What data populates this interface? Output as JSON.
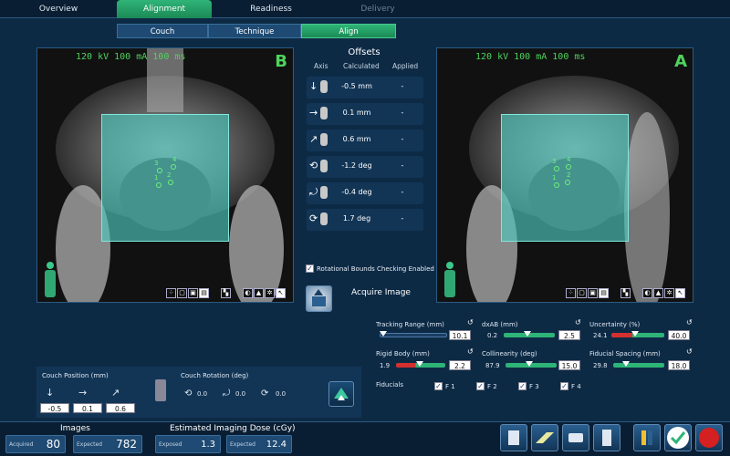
{
  "tabs": [
    {
      "label": "Overview"
    },
    {
      "label": "Alignment"
    },
    {
      "label": "Readiness"
    },
    {
      "label": "Delivery"
    }
  ],
  "steps": [
    {
      "label": "Couch"
    },
    {
      "label": "Technique"
    },
    {
      "label": "Align"
    }
  ],
  "imageB": {
    "kv": "120 kV 100 mA 100 ms",
    "letter": "B",
    "fiducials": [
      "3",
      "4",
      "1",
      "2"
    ]
  },
  "imageA": {
    "kv": "120 kV 100 mA 100 ms",
    "letter": "A",
    "fiducials": [
      "3",
      "4",
      "1",
      "2"
    ]
  },
  "offsets": {
    "title": "Offsets",
    "head_axis": "Axis",
    "head_calc": "Calculated",
    "head_app": "Applied",
    "rows": [
      {
        "icon": "arrow-down-icon",
        "calc": "-0.5 mm",
        "applied": "-"
      },
      {
        "icon": "arrow-right-icon",
        "calc": "0.1 mm",
        "applied": "-"
      },
      {
        "icon": "arrow-diagonal-icon",
        "calc": "0.6 mm",
        "applied": "-"
      },
      {
        "icon": "rotate-roll-icon",
        "calc": "-1.2 deg",
        "applied": "-"
      },
      {
        "icon": "rotate-pitch-icon",
        "calc": "-0.4 deg",
        "applied": "-"
      },
      {
        "icon": "rotate-yaw-icon",
        "calc": "1.7 deg",
        "applied": "-"
      }
    ]
  },
  "rot_check": {
    "label": "Rotational Bounds Checking Enabled",
    "checked": true
  },
  "acquire": {
    "label": "Acquire Image"
  },
  "couch_position": {
    "label": "Couch Position (mm)",
    "values": [
      "-0.5",
      "0.1",
      "0.6"
    ]
  },
  "couch_rotation": {
    "label": "Couch Rotation (deg)",
    "values": [
      "0.0",
      "0.0",
      "0.0"
    ]
  },
  "tolerances": {
    "tracking_range": {
      "label": "Tracking Range (mm)",
      "value": "10.1"
    },
    "dxab": {
      "label": "dxAB (mm)",
      "left": "0.2",
      "value": "2.5"
    },
    "uncertainty": {
      "label": "Uncertainty (%)",
      "left": "24.1",
      "value": "40.0"
    },
    "rigid_body": {
      "label": "Rigid Body (mm)",
      "left": "1.9",
      "value": "2.2"
    },
    "collinearity": {
      "label": "Collinearity (deg)",
      "left": "87.9",
      "value": "15.0"
    },
    "fiducial_spacing": {
      "label": "Fiducial Spacing (mm)",
      "left": "29.8",
      "value": "18.0"
    }
  },
  "fiducials": {
    "label": "Fiducials",
    "items": [
      "F 1",
      "F 2",
      "F 3",
      "F 4"
    ]
  },
  "footer": {
    "images_title": "Images",
    "acquired_label": "Acquired",
    "acquired": "80",
    "expected_label": "Expected",
    "expected": "782",
    "dose_title": "Estimated Imaging Dose (cGy)",
    "exposed_label": "Exposed",
    "exposed": "1.3",
    "dose_expected_label": "Expected",
    "dose_expected": "12.4"
  },
  "colors": {
    "accent": "#2fb478",
    "panel": "#123556",
    "bg": "#0d2a45"
  }
}
